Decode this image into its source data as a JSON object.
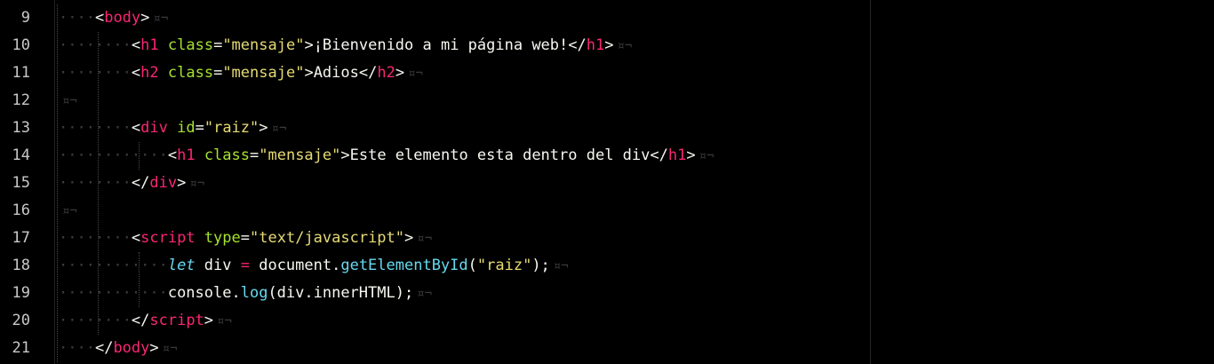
{
  "editor": {
    "eol_marker": "¤¬",
    "lines": [
      {
        "number": "9",
        "indent": "····",
        "tokens": [
          [
            "punc",
            "<"
          ],
          [
            "tag",
            "body"
          ],
          [
            "punc",
            ">"
          ]
        ]
      },
      {
        "number": "10",
        "indent": "········",
        "tokens": [
          [
            "punc",
            "<"
          ],
          [
            "tag",
            "h1"
          ],
          [
            "text",
            " "
          ],
          [
            "attr",
            "class"
          ],
          [
            "punc",
            "="
          ],
          [
            "str",
            "\"mensaje\""
          ],
          [
            "punc",
            ">"
          ],
          [
            "text",
            "¡Bienvenido a mi página web!"
          ],
          [
            "punc",
            "</"
          ],
          [
            "tag",
            "h1"
          ],
          [
            "punc",
            ">"
          ]
        ]
      },
      {
        "number": "11",
        "indent": "········",
        "tokens": [
          [
            "punc",
            "<"
          ],
          [
            "tag",
            "h2"
          ],
          [
            "text",
            " "
          ],
          [
            "attr",
            "class"
          ],
          [
            "punc",
            "="
          ],
          [
            "str",
            "\"mensaje\""
          ],
          [
            "punc",
            ">"
          ],
          [
            "text",
            "Adios"
          ],
          [
            "punc",
            "</"
          ],
          [
            "tag",
            "h2"
          ],
          [
            "punc",
            ">"
          ]
        ]
      },
      {
        "number": "12",
        "indent": "",
        "tokens": []
      },
      {
        "number": "13",
        "indent": "········",
        "tokens": [
          [
            "punc",
            "<"
          ],
          [
            "tag",
            "div"
          ],
          [
            "text",
            " "
          ],
          [
            "attr",
            "id"
          ],
          [
            "punc",
            "="
          ],
          [
            "str",
            "\"raiz\""
          ],
          [
            "punc",
            ">"
          ]
        ]
      },
      {
        "number": "14",
        "indent": "············",
        "tokens": [
          [
            "punc",
            "<"
          ],
          [
            "tag",
            "h1"
          ],
          [
            "text",
            " "
          ],
          [
            "attr",
            "class"
          ],
          [
            "punc",
            "="
          ],
          [
            "str",
            "\"mensaje\""
          ],
          [
            "punc",
            ">"
          ],
          [
            "text",
            "Este elemento esta dentro del div"
          ],
          [
            "punc",
            "</"
          ],
          [
            "tag",
            "h1"
          ],
          [
            "punc",
            ">"
          ]
        ]
      },
      {
        "number": "15",
        "indent": "········",
        "tokens": [
          [
            "punc",
            "</"
          ],
          [
            "tag",
            "div"
          ],
          [
            "punc",
            ">"
          ]
        ]
      },
      {
        "number": "16",
        "indent": "",
        "tokens": []
      },
      {
        "number": "17",
        "indent": "········",
        "tokens": [
          [
            "punc",
            "<"
          ],
          [
            "tag",
            "script"
          ],
          [
            "text",
            " "
          ],
          [
            "attr",
            "type"
          ],
          [
            "punc",
            "="
          ],
          [
            "str",
            "\"text/javascript\""
          ],
          [
            "punc",
            ">"
          ]
        ]
      },
      {
        "number": "18",
        "indent": "············",
        "tokens": [
          [
            "kw",
            "let"
          ],
          [
            "text",
            " div "
          ],
          [
            "op",
            "="
          ],
          [
            "text",
            " document."
          ],
          [
            "fn",
            "getElementById"
          ],
          [
            "text",
            "("
          ],
          [
            "str",
            "\"raiz\""
          ],
          [
            "text",
            ");"
          ]
        ]
      },
      {
        "number": "19",
        "indent": "············",
        "tokens": [
          [
            "text",
            "console."
          ],
          [
            "fn",
            "log"
          ],
          [
            "text",
            "(div.innerHTML);"
          ]
        ]
      },
      {
        "number": "20",
        "indent": "········",
        "tokens": [
          [
            "punc",
            "</"
          ],
          [
            "tag",
            "script"
          ],
          [
            "punc",
            ">"
          ]
        ]
      },
      {
        "number": "21",
        "indent": "····",
        "tokens": [
          [
            "punc",
            "</"
          ],
          [
            "tag",
            "body"
          ],
          [
            "punc",
            ">"
          ]
        ]
      }
    ]
  }
}
